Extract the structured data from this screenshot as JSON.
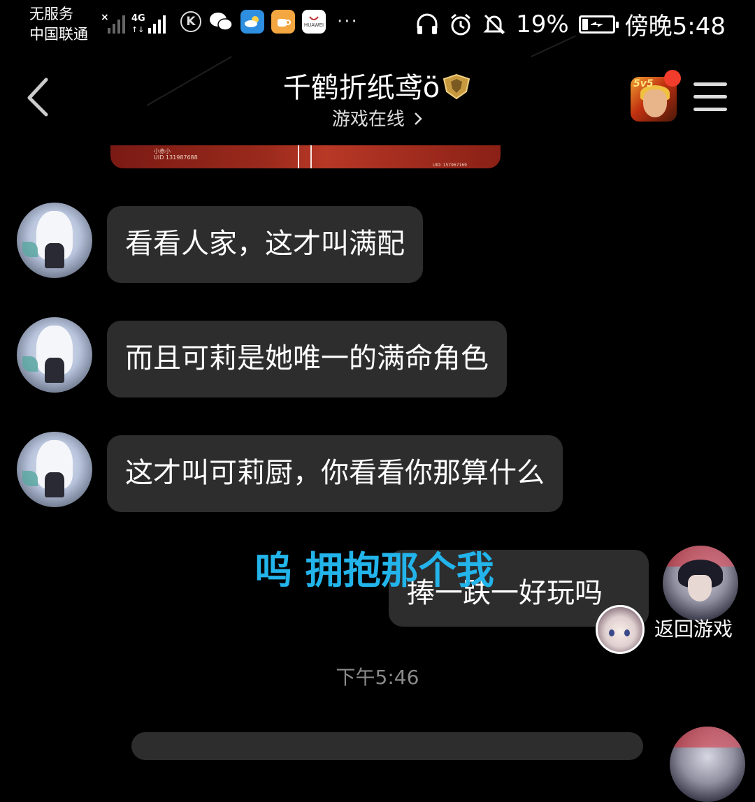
{
  "status_bar": {
    "carrier_line1": "无服务",
    "carrier_line2": "中国联通",
    "network": "4G",
    "app_icon_k": "K",
    "huawei_label": "HUAWEI",
    "more": "···",
    "battery": "19%",
    "battery_level": 0.19,
    "time": "傍晚5:48",
    "icons": [
      "x-signal-icon",
      "signal-4g-icon",
      "k-app-icon",
      "wechat-icon",
      "weather-icon",
      "tea-app-icon",
      "huawei-appgallery-icon",
      "headphones-icon",
      "alarm-icon",
      "mute-bell-icon",
      "battery-icon"
    ]
  },
  "header": {
    "title": "千鹤折纸鸢ö",
    "subtitle": "游戏在线",
    "game_icon_label": "5v5",
    "icons": [
      "back-chevron-icon",
      "gold-badge-icon",
      "chevron-right-icon",
      "game-app-icon",
      "menu-icon"
    ]
  },
  "image_strip": {
    "line1": "小赤小",
    "line2": "UID 131987688",
    "line3": "UID: 157967169"
  },
  "messages": [
    {
      "side": "left",
      "text": "看看人家，这才叫满配"
    },
    {
      "side": "left",
      "text": "而且可莉是她唯一的满命角色"
    },
    {
      "side": "left",
      "text": "这才叫可莉厨，你看看你那算什么"
    },
    {
      "side": "right",
      "text": "捧一趺一好玩吗"
    }
  ],
  "overlay_lyric": "呜 拥抱那个我",
  "floating": {
    "label": "返回游戏"
  },
  "timestamp": "下午5:46",
  "colors": {
    "background": "#000000",
    "bubble": "#2d2d2d",
    "lyric": "#22b4ea",
    "timestamp": "#8a8a8a",
    "badge_red": "#f23d2c"
  }
}
